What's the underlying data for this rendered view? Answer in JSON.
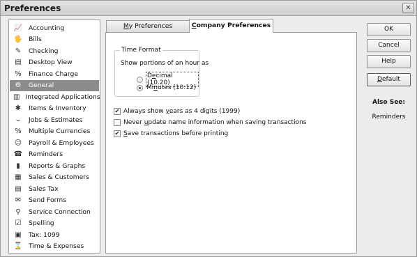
{
  "window": {
    "title": "Preferences",
    "close_glyph": "✕"
  },
  "categories": [
    {
      "label": "Accounting",
      "icon": "accounting-icon",
      "glyph": "📈"
    },
    {
      "label": "Bills",
      "icon": "bills-icon",
      "glyph": "🖐"
    },
    {
      "label": "Checking",
      "icon": "checking-icon",
      "glyph": "✎"
    },
    {
      "label": "Desktop View",
      "icon": "desktop-view-icon",
      "glyph": "▤"
    },
    {
      "label": "Finance Charge",
      "icon": "finance-charge-icon",
      "glyph": "%"
    },
    {
      "label": "General",
      "icon": "general-icon",
      "glyph": "⚙"
    },
    {
      "label": "Integrated Applications",
      "icon": "integrated-applications-icon",
      "glyph": "▥"
    },
    {
      "label": "Items & Inventory",
      "icon": "items-inventory-icon",
      "glyph": "✱"
    },
    {
      "label": "Jobs & Estimates",
      "icon": "jobs-estimates-icon",
      "glyph": "⌣"
    },
    {
      "label": "Multiple Currencies",
      "icon": "multiple-currencies-icon",
      "glyph": "%"
    },
    {
      "label": "Payroll & Employees",
      "icon": "payroll-employees-icon",
      "glyph": "☺"
    },
    {
      "label": "Reminders",
      "icon": "reminders-icon",
      "glyph": "☎"
    },
    {
      "label": "Reports & Graphs",
      "icon": "reports-graphs-icon",
      "glyph": "▮"
    },
    {
      "label": "Sales & Customers",
      "icon": "sales-customers-icon",
      "glyph": "▦"
    },
    {
      "label": "Sales Tax",
      "icon": "sales-tax-icon",
      "glyph": "▤"
    },
    {
      "label": "Send Forms",
      "icon": "send-forms-icon",
      "glyph": "✉"
    },
    {
      "label": "Service Connection",
      "icon": "service-connection-icon",
      "glyph": "⚲"
    },
    {
      "label": "Spelling",
      "icon": "spelling-icon",
      "glyph": "☑"
    },
    {
      "label": "Tax: 1099",
      "icon": "tax-1099-icon",
      "glyph": "▣"
    },
    {
      "label": "Time & Expenses",
      "icon": "time-expenses-icon",
      "glyph": "⌛"
    }
  ],
  "selected_category": "General",
  "tabs": {
    "my_preferences": {
      "pre": "",
      "key": "M",
      "post": "y Preferences"
    },
    "company_preferences": {
      "pre": "",
      "key": "C",
      "post": "ompany Preferences"
    }
  },
  "time_format": {
    "legend": "Time Format",
    "subtitle": "Show portions of an hour as",
    "decimal": {
      "pre": "D",
      "key": "e",
      "post": "cimal (10.20)",
      "checked": false
    },
    "minutes": {
      "pre": "Mi",
      "key": "n",
      "post": "utes (10:12)",
      "checked": true
    }
  },
  "options": {
    "years4": {
      "pre": "Always show ",
      "key": "y",
      "post": "ears as 4 digits (1999)",
      "checked": true
    },
    "never_update": {
      "pre": "Never ",
      "key": "u",
      "post": "pdate name information when saving transactions",
      "checked": false
    },
    "save_before_print": {
      "pre": "",
      "key": "S",
      "post": "ave transactions before printing",
      "checked": true
    }
  },
  "buttons": {
    "ok": "OK",
    "cancel": "Cancel",
    "help": "Help",
    "default": {
      "pre": "",
      "key": "D",
      "post": "efault"
    }
  },
  "also_see": {
    "title": "Also See:",
    "links": [
      "Reminders"
    ]
  }
}
